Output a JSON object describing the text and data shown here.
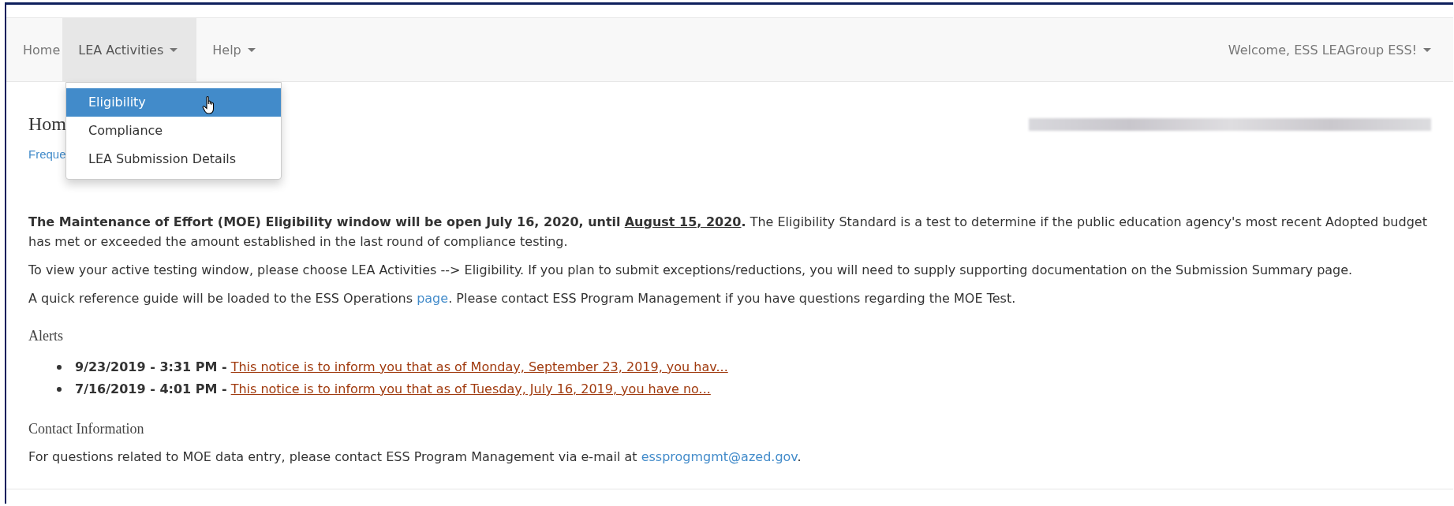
{
  "navbar": {
    "items": [
      {
        "label": "Home",
        "caret": false,
        "open": false
      },
      {
        "label": "LEA Activities",
        "caret": true,
        "open": true
      },
      {
        "label": "Help",
        "caret": true,
        "open": false
      }
    ],
    "user_menu": {
      "label": "Welcome, ESS LEAGroup ESS!",
      "caret": true
    }
  },
  "dropdown": {
    "items": [
      {
        "label": "Eligibility",
        "selected": true
      },
      {
        "label": "Compliance",
        "selected": false
      },
      {
        "label": "LEA Submission Details",
        "selected": false
      }
    ]
  },
  "heading": "Hom",
  "faq_link": "Freque",
  "notice": {
    "lead": "**The Maintenance of Effort (MOE) Eligibility window will be open July 16, 2020, until**",
    "date": "August 15, 2020",
    "rest": ". The Eligibility Standard is a test to determine if the public education agency's most recent Adopted budget has met or exceeded the amount established in the last round of compliance testing."
  },
  "instructions": "To view your active testing window, please choose LEA Activities --> Eligibility. If you plan to submit exceptions/reductions, you will need to supply supporting documentation on the Submission Summary page.",
  "reference": {
    "before": "A quick reference guide will be loaded to the ESS Operations",
    "link": "page",
    "after": ". Please contact ESS Program Management if you have questions regarding the MOE Test."
  },
  "alerts": {
    "title": "Alerts",
    "items": [
      {
        "timestamp": "9/23/2019 - 3:31 PM -",
        "text": "This notice is to inform you that as of Monday, September 23, 2019, you hav..."
      },
      {
        "timestamp": "7/16/2019 - 4:01 PM -",
        "text": "This notice is to inform you that as of Tuesday, July 16, 2019, you have no..."
      }
    ]
  },
  "contact": {
    "title": "Contact Information",
    "before": "For questions related to MOE data entry, please contact ESS Program Management via e-mail at",
    "email": "essprogmgmt@azed.gov",
    "after": "."
  }
}
